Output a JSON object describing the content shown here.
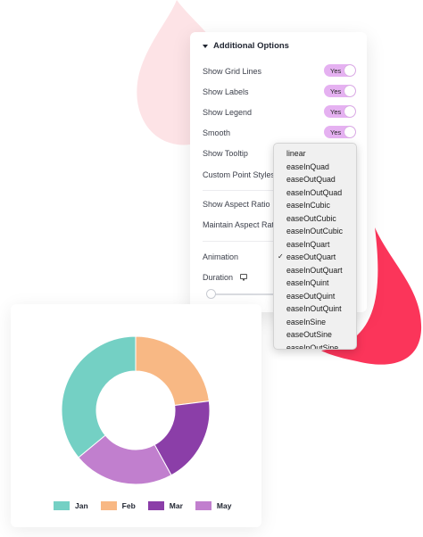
{
  "panel": {
    "title": "Additional Options",
    "toggle_rows": [
      {
        "label": "Show Grid Lines",
        "value": "Yes"
      },
      {
        "label": "Show Labels",
        "value": "Yes"
      },
      {
        "label": "Show Legend",
        "value": "Yes"
      },
      {
        "label": "Smooth",
        "value": "Yes"
      }
    ],
    "other_rows": [
      {
        "label": "Show Tooltip"
      },
      {
        "label": "Custom Point Styles"
      },
      {
        "label": "Show Aspect Ratio"
      },
      {
        "label": "Maintain Aspect Ratio"
      },
      {
        "label": "Animation"
      },
      {
        "label": "Duration"
      }
    ]
  },
  "dropdown": {
    "options": [
      "linear",
      "easeInQuad",
      "easeOutQuad",
      "easeInOutQuad",
      "easeInCubic",
      "easeOutCubic",
      "easeInOutCubic",
      "easeInQuart",
      "easeOutQuart",
      "easeInOutQuart",
      "easeInQuint",
      "easeOutQuint",
      "easeInOutQuint",
      "easeInSine",
      "easeOutSine",
      "easeInOutSine"
    ],
    "selected": "easeOutQuart",
    "check_glyph": "✓"
  },
  "chart_data": {
    "type": "pie",
    "variant": "doughnut",
    "categories": [
      "Jan",
      "Feb",
      "Mar",
      "May"
    ],
    "values": [
      36,
      23,
      19,
      22
    ],
    "colors": [
      "#74d0c4",
      "#f8b884",
      "#8b3ea8",
      "#c17fce"
    ],
    "legend_position": "bottom"
  },
  "colors": {
    "toggle_on": "#e5b1f1",
    "blob_pink": "#fde3e6",
    "blob_red": "#fb355a"
  }
}
